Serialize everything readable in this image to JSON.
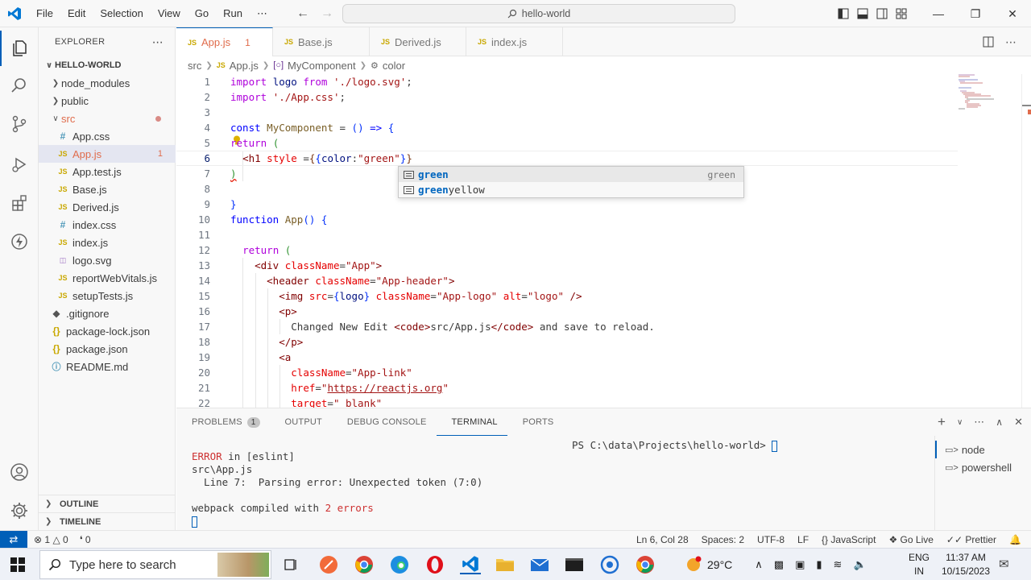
{
  "titlebar": {
    "menu": [
      "File",
      "Edit",
      "Selection",
      "View",
      "Go",
      "Run",
      "⋯"
    ],
    "search": "hello-world"
  },
  "sidebar": {
    "title": "EXPLORER",
    "root": "HELLO-WORLD",
    "tree": [
      {
        "label": "node_modules",
        "type": "folder",
        "expanded": false,
        "depth": 1
      },
      {
        "label": "public",
        "type": "folder",
        "expanded": false,
        "depth": 1
      },
      {
        "label": "src",
        "type": "folder",
        "expanded": true,
        "depth": 1,
        "error": true
      },
      {
        "label": "App.css",
        "type": "css",
        "depth": 2
      },
      {
        "label": "App.js",
        "type": "js",
        "depth": 2,
        "error": true,
        "badge": "1",
        "selected": true
      },
      {
        "label": "App.test.js",
        "type": "js",
        "depth": 2
      },
      {
        "label": "Base.js",
        "type": "js",
        "depth": 2
      },
      {
        "label": "Derived.js",
        "type": "js",
        "depth": 2
      },
      {
        "label": "index.css",
        "type": "css",
        "depth": 2
      },
      {
        "label": "index.js",
        "type": "js",
        "depth": 2
      },
      {
        "label": "logo.svg",
        "type": "svg",
        "depth": 2
      },
      {
        "label": "reportWebVitals.js",
        "type": "js",
        "depth": 2
      },
      {
        "label": "setupTests.js",
        "type": "js",
        "depth": 2
      },
      {
        "label": ".gitignore",
        "type": "git",
        "depth": 1
      },
      {
        "label": "package-lock.json",
        "type": "json",
        "depth": 1
      },
      {
        "label": "package.json",
        "type": "json",
        "depth": 1
      },
      {
        "label": "README.md",
        "type": "info",
        "depth": 1
      }
    ],
    "outline": "OUTLINE",
    "timeline": "TIMELINE"
  },
  "tabs": [
    {
      "label": "App.js",
      "badge": "1",
      "active": true
    },
    {
      "label": "Base.js"
    },
    {
      "label": "Derived.js"
    },
    {
      "label": "index.js"
    }
  ],
  "breadcrumb": [
    "src",
    "App.js",
    "MyComponent",
    "color"
  ],
  "editor": {
    "line_numbers": [
      "1",
      "2",
      "3",
      "4",
      "5",
      "6",
      "7",
      "8",
      "9",
      "10",
      "11",
      "12",
      "13",
      "14",
      "15",
      "16",
      "17",
      "18",
      "19",
      "20",
      "21",
      "22"
    ],
    "current_line": 6
  },
  "suggest": [
    {
      "match": "green",
      "rest": "",
      "detail": "green"
    },
    {
      "match": "green",
      "rest": "yellow",
      "detail": ""
    }
  ],
  "panel": {
    "tabs": [
      "PROBLEMS",
      "OUTPUT",
      "DEBUG CONSOLE",
      "TERMINAL",
      "PORTS"
    ],
    "problems_count": "1",
    "active_tab": "TERMINAL",
    "output": {
      "error_word": "ERROR",
      "error_rest": " in [eslint]",
      "file": "src\\App.js",
      "detail": "  Line 7:  Parsing error: Unexpected token (7:0)",
      "compiled_pre": "webpack compiled with ",
      "compiled_err": "2 errors"
    },
    "prompt": "PS C:\\data\\Projects\\hello-world> ",
    "terminals": [
      "node",
      "powershell"
    ]
  },
  "statusbar": {
    "errors": "1",
    "warnings": "0",
    "ports": "0",
    "position": "Ln 6, Col 28",
    "spaces": "Spaces: 2",
    "encoding": "UTF-8",
    "eol": "LF",
    "language": "JavaScript",
    "golive": "Go Live",
    "prettier": "Prettier"
  },
  "taskbar": {
    "search_placeholder": "Type here to search",
    "weather": "29°C",
    "lang_line1": "ENG",
    "lang_line2": "IN",
    "time": "11:37 AM",
    "date": "10/15/2023"
  },
  "colors": {
    "accent": "#005fb8",
    "error": "#e06c4c",
    "js_icon": "#c9a800"
  }
}
